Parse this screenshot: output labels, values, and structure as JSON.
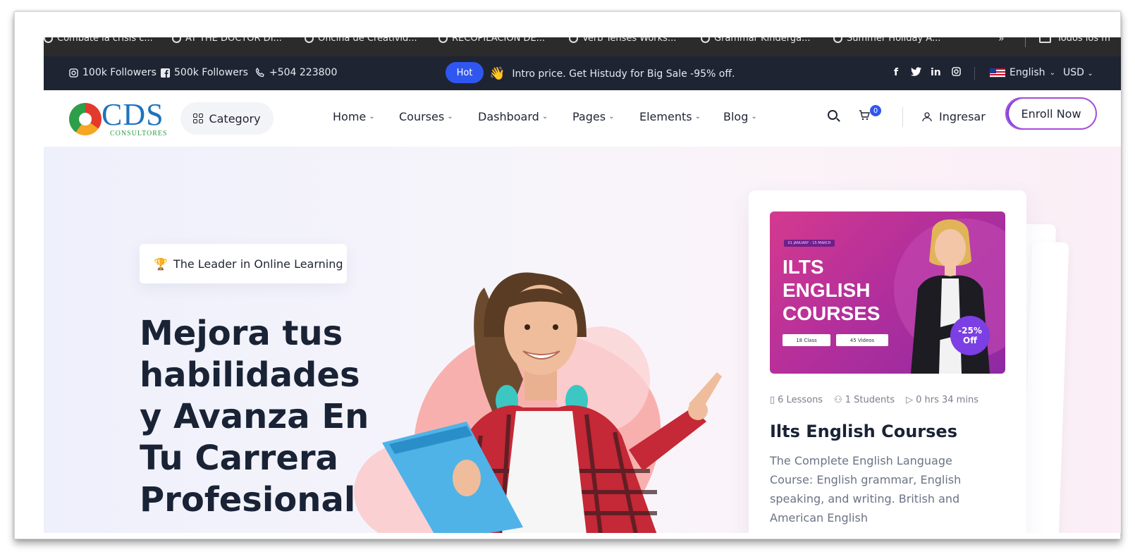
{
  "bookmarks": {
    "items": [
      "Combate la crisis c...",
      "AT THE DOCTOR DI...",
      "Oficina de Creativid...",
      "RECOPILACION DE...",
      "Verb Tenses Works...",
      "Grammar Kinderga...",
      "Summer Holiday A..."
    ],
    "more": "»",
    "all": "Todos los m"
  },
  "topbar": {
    "instagram": "100k Followers",
    "facebook": "500k Followers",
    "phone": "+504 223800",
    "hot_label": "Hot",
    "promo_emoji": "👋",
    "promo_text": "Intro price. Get Histudy for Big Sale -95% off.",
    "social": [
      "f",
      "t",
      "in",
      "ig"
    ],
    "language": "English",
    "currency": "USD"
  },
  "nav": {
    "logo_text": "CDS",
    "logo_sub": "CONSULTORES",
    "category_label": "Category",
    "menu": [
      "Home",
      "Courses",
      "Dashboard",
      "Pages",
      "Elements",
      "Blog"
    ],
    "cart_count": "0",
    "login_label": "Ingresar",
    "enroll_label": "Enroll Now"
  },
  "hero": {
    "badge_text": "The Leader in Online Learning",
    "headline": [
      "Mejora tus",
      "habilidades",
      "y Avanza En",
      "Tu Carrera",
      "Profesional."
    ]
  },
  "course_card": {
    "thumb_date": "01 JANUARY - 15 MARCH",
    "thumb_title": [
      "ILTS",
      "ENGLISH",
      "COURSES"
    ],
    "thumb_class": "18 Class",
    "thumb_videos": "45 Videos",
    "thumb_discount": "-25% Off",
    "lessons": "6 Lessons",
    "students": "1 Students",
    "duration": "0 hrs 34 mins",
    "title": "Ilts English Courses",
    "description": "The Complete English Language Course: English grammar, English speaking, and writing. British and American English"
  },
  "colors": {
    "accent": "#2f57ef",
    "topbar_bg": "#1f2433",
    "headline": "#192335",
    "purple": "#7b3fe4"
  }
}
